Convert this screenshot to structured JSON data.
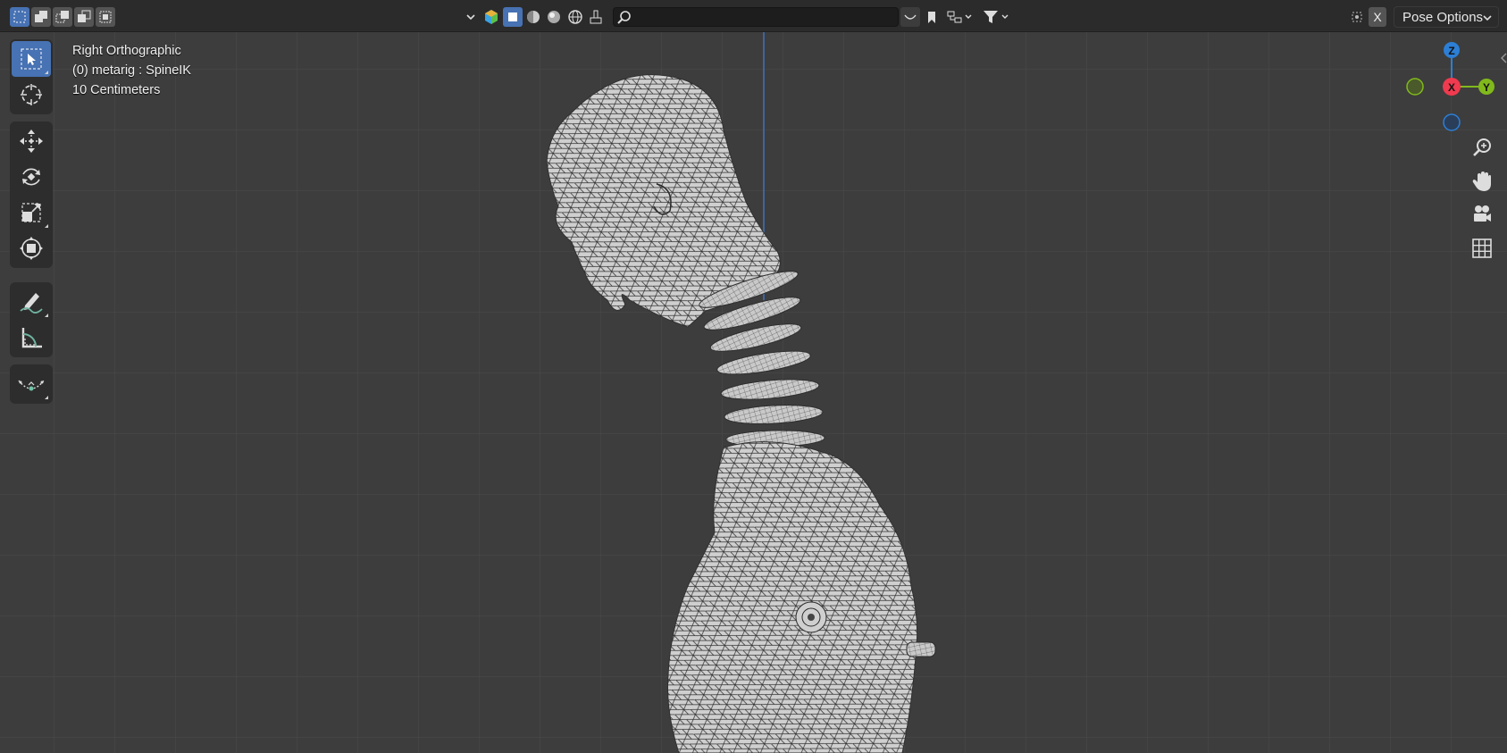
{
  "header": {
    "search": {
      "value": "",
      "placeholder": ""
    },
    "x_label": "X",
    "pose_options_label": "Pose Options"
  },
  "viewport": {
    "view_name": "Right Orthographic",
    "object_label": "(0) metarig : SpineIK",
    "grid_scale": "10 Centimeters"
  },
  "gizmo": {
    "z_label": "Z",
    "x_label": "X",
    "y_label": "Y",
    "colors": {
      "x": "#f03a4f",
      "y": "#81b91c",
      "z": "#2c7fd6"
    }
  },
  "toolbar": {
    "tools": [
      "select-box",
      "cursor",
      "move",
      "rotate",
      "scale",
      "transform",
      "annotate",
      "measure",
      "relax"
    ]
  },
  "colors": {
    "accent": "#4772b3",
    "viewport_bg": "#3d3d3d",
    "header_bg": "#2b2b2b"
  }
}
